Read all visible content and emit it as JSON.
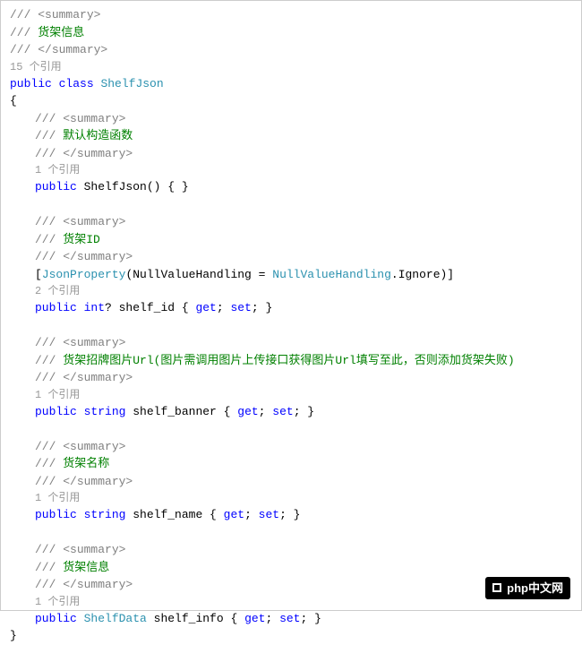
{
  "triple_slash": "///",
  "summary_open": "<summary>",
  "summary_close": "</summary>",
  "class_summary": "货架信息",
  "class_refs": "15 个引用",
  "kw_public": "public",
  "kw_class": "class",
  "class_name": "ShelfJson",
  "brace_open": "{",
  "brace_close": "}",
  "sections": {
    "ctor": {
      "summary": "默认构造函数",
      "refs": "1 个引用",
      "sig_open": " ShelfJson() { }"
    },
    "shelf_id": {
      "summary": "货架ID",
      "attr_open": "[",
      "attr_json": "JsonProperty",
      "attr_mid": "(NullValueHandling = ",
      "attr_enum": "NullValueHandling",
      "attr_tail": ".Ignore)]",
      "refs": "2 个引用",
      "type_kw": "int",
      "name": "? shelf_id { ",
      "get": "get",
      "set": "set",
      "sep": "; ",
      "end": "; }"
    },
    "shelf_banner": {
      "summary": "货架招牌图片Url(图片需调用图片上传接口获得图片Url填写至此，否则添加货架失败)",
      "refs": "1 个引用",
      "type_kw": "string",
      "name": " shelf_banner { ",
      "get": "get",
      "set": "set",
      "sep": "; ",
      "end": "; }"
    },
    "shelf_name": {
      "summary": "货架名称",
      "refs": "1 个引用",
      "type_kw": "string",
      "name": " shelf_name { ",
      "get": "get",
      "set": "set",
      "sep": "; ",
      "end": "; }"
    },
    "shelf_info": {
      "summary": "货架信息",
      "refs": "1 个引用",
      "type_name": "ShelfData",
      "name": " shelf_info { ",
      "get": "get",
      "set": "set",
      "sep": "; ",
      "end": "; }"
    }
  },
  "watermark": "php中文网"
}
